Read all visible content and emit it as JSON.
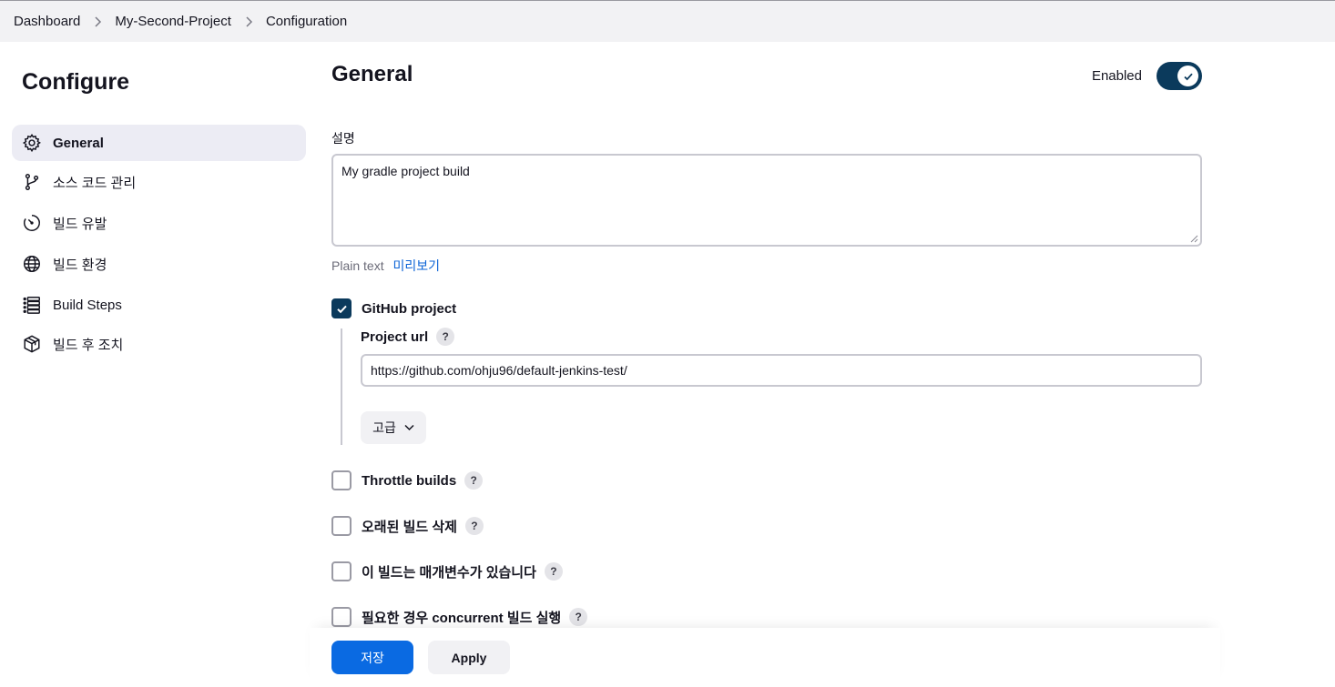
{
  "breadcrumb": {
    "items": [
      "Dashboard",
      "My-Second-Project",
      "Configuration"
    ]
  },
  "sidebar": {
    "title": "Configure",
    "items": [
      {
        "label": "General",
        "icon": "gear-icon",
        "active": true
      },
      {
        "label": "소스 코드 관리",
        "icon": "branch-icon",
        "active": false
      },
      {
        "label": "빌드 유발",
        "icon": "timer-icon",
        "active": false
      },
      {
        "label": "빌드 환경",
        "icon": "globe-icon",
        "active": false
      },
      {
        "label": "Build Steps",
        "icon": "list-icon",
        "active": false
      },
      {
        "label": "빌드 후 조치",
        "icon": "package-icon",
        "active": false
      }
    ]
  },
  "general": {
    "title": "General",
    "enabled_label": "Enabled",
    "enabled": true,
    "description_label": "설명",
    "description_value": "My gradle project build",
    "plain_text": "Plain text",
    "preview_link": "미리보기",
    "github_project": {
      "label": "GitHub project",
      "checked": true,
      "help": "?"
    },
    "project_url": {
      "label": "Project url",
      "help": "?",
      "value": "https://github.com/ohju96/default-jenkins-test/"
    },
    "advanced_label": "고급",
    "options": [
      {
        "label": "Throttle builds",
        "checked": false,
        "help": "?"
      },
      {
        "label": "오래된 빌드 삭제",
        "checked": false,
        "help": "?"
      },
      {
        "label": "이 빌드는 매개변수가 있습니다",
        "checked": false,
        "help": "?"
      },
      {
        "label": "필요한 경우 concurrent 빌드 실행",
        "checked": false,
        "help": "?"
      }
    ]
  },
  "actions": {
    "save_label": "저장",
    "apply_label": "Apply"
  },
  "colors": {
    "primary": "#0a6ae2",
    "toggle_on": "#0b3a5c",
    "link": "#0b63d6",
    "sidebar_active": "#ececf4"
  }
}
